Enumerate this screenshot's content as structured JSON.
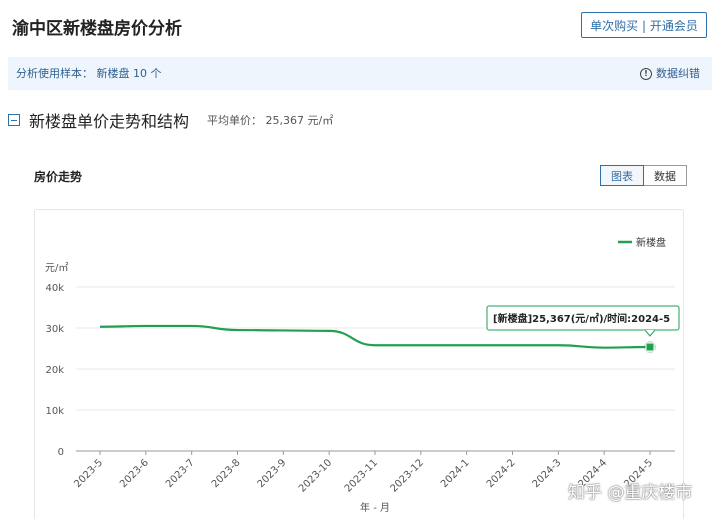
{
  "header": {
    "title": "渝中区新楼盘房价分析",
    "buy_label": "单次购买 | 开通会员"
  },
  "info_bar": {
    "sample_text": "分析使用样本：  新楼盘 10 个",
    "feedback_label": "数据纠错",
    "info_icon": "!"
  },
  "section": {
    "title": "新楼盘单价走势和结构",
    "avg_label": "平均单价：  25,367 元/㎡"
  },
  "chart_panel": {
    "title": "房价走势",
    "tab_chart": "图表",
    "tab_data": "数据"
  },
  "tooltip": {
    "text": "[新楼盘]25,367(元/㎡)/时间:2024-5"
  },
  "watermark": "知乎 @重庆楼市",
  "chart_data": {
    "type": "line",
    "ylabel": "元/㎡",
    "xlabel": "年 - 月",
    "ylim": [
      0,
      40000
    ],
    "yticks": [
      0,
      10000,
      20000,
      30000,
      40000
    ],
    "ytick_labels": [
      "0",
      "10k",
      "20k",
      "30k",
      "40k"
    ],
    "x": [
      "2023-5",
      "2023-6",
      "2023-7",
      "2023-8",
      "2023-9",
      "2023-10",
      "2023-11",
      "2023-12",
      "2024-1",
      "2024-2",
      "2024-3",
      "2024-4",
      "2024-5"
    ],
    "grid": true,
    "legend_position": "top-right",
    "series": [
      {
        "name": "新楼盘",
        "color": "#22a050",
        "values": [
          30300,
          30500,
          30500,
          29500,
          29400,
          29300,
          25800,
          25800,
          25800,
          25800,
          25800,
          25200,
          25367
        ]
      }
    ]
  }
}
